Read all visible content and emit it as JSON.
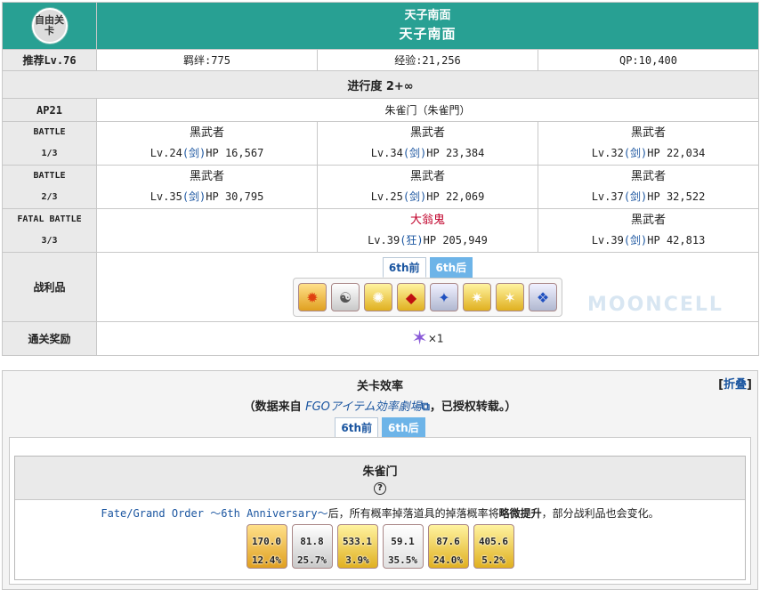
{
  "header": {
    "badge": "自由关卡",
    "title_small": "天子南面",
    "title_large": "天子南面"
  },
  "stats": {
    "recommend": "推荐Lv.76",
    "bond": "羁绊:775",
    "exp": "经验:21,256",
    "qp": "QP:10,400"
  },
  "progress": "进行度 2+∞",
  "ap": {
    "label": "AP21",
    "location": "朱雀门（朱雀門）"
  },
  "battles": [
    {
      "label1": "BATTLE",
      "label2": "1/3",
      "enemies": [
        {
          "name": "黑武者",
          "lv": "Lv.24",
          "cls": "(剑)",
          "hp": "HP 16,567"
        },
        {
          "name": "黑武者",
          "lv": "Lv.34",
          "cls": "(剑)",
          "hp": "HP 23,384"
        },
        {
          "name": "黑武者",
          "lv": "Lv.32",
          "cls": "(剑)",
          "hp": "HP 22,034"
        }
      ]
    },
    {
      "label1": "BATTLE",
      "label2": "2/3",
      "enemies": [
        {
          "name": "黑武者",
          "lv": "Lv.35",
          "cls": "(剑)",
          "hp": "HP 30,795"
        },
        {
          "name": "黑武者",
          "lv": "Lv.25",
          "cls": "(剑)",
          "hp": "HP 22,069"
        },
        {
          "name": "黑武者",
          "lv": "Lv.37",
          "cls": "(剑)",
          "hp": "HP 32,522"
        }
      ]
    },
    {
      "label1": "FATAL BATTLE",
      "label2": "3/3",
      "enemies": [
        {
          "name": "大翁鬼",
          "lv": "Lv.39",
          "cls": "(狂)",
          "hp": "HP 205,949"
        },
        {
          "name": "黑武者",
          "lv": "Lv.39",
          "cls": "(剑)",
          "hp": "HP 42,813"
        }
      ]
    }
  ],
  "drops": {
    "label": "战利品",
    "tab_before": "6th前",
    "tab_after": "6th后",
    "items": [
      "fire-gem-icon",
      "yin-yang-icon",
      "gold-gear-icon",
      "red-gem-icon",
      "silver-crystal-icon",
      "gold-piece-icon",
      "gold-monument-icon",
      "blue-crystal-icon"
    ]
  },
  "reward": {
    "label": "通关奖励",
    "count": "×1",
    "icon": "saint-quartz-icon"
  },
  "watermark": "MOONCELL",
  "efficiency": {
    "title": "关卡效率",
    "fold": "折叠",
    "source_prefix": "（数据来自 ",
    "source_link": "FGOアイテム効率劇場",
    "source_suffix": "，已授权转载。）",
    "tab_before": "6th前",
    "tab_after": "6th后",
    "quest_name": "朱雀门",
    "help": "?",
    "note_link": "Fate/Grand Order ～6th Anniversary～",
    "note_mid": "后，所有概率掉落道具的掉落概率将",
    "note_bold": "略微提升",
    "note_end": "，部分战利品也会变化。",
    "rates": [
      {
        "icon": "fire-gem-icon",
        "ap": "170.0",
        "rate": "12.4%"
      },
      {
        "icon": "yin-yang-icon",
        "ap": "81.8",
        "rate": "25.7%"
      },
      {
        "icon": "gold-gear-icon",
        "ap": "533.1",
        "rate": "3.9%"
      },
      {
        "icon": "red-gem-icon",
        "ap": "59.1",
        "rate": "35.5%"
      },
      {
        "icon": "gold-piece-icon",
        "ap": "87.6",
        "rate": "24.0%"
      },
      {
        "icon": "gold-monument-icon",
        "ap": "405.6",
        "rate": "5.2%"
      }
    ]
  }
}
